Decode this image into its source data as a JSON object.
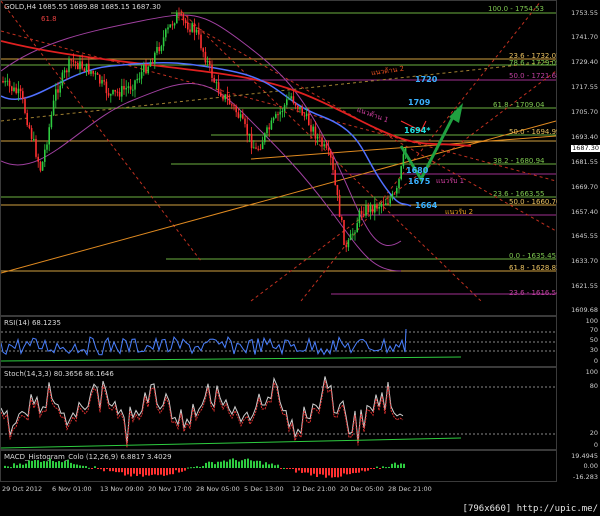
{
  "symbol_title": "GOLD,H4  1685.55 1689.88 1685.15 1687.30",
  "price_axis": [
    "1753.55",
    "1741.70",
    "1729.40",
    "1717.55",
    "1705.70",
    "1693.40",
    "1681.55",
    "1669.70",
    "1657.40",
    "1645.55",
    "1633.70",
    "1621.55",
    "1609.68"
  ],
  "current_price": "1687.30",
  "fib_labels": [
    {
      "text": "100.0 - 1754.53",
      "color": "#7ec850"
    },
    {
      "text": "23.6 - 1732.01",
      "color": "#e8c060"
    },
    {
      "text": "78.6 - 1729.05",
      "color": "#7ec850"
    },
    {
      "text": "50.0 - 1721.68",
      "color": "#c040a0"
    },
    {
      "text": "61.8 - 1709.04",
      "color": "#7ec850"
    },
    {
      "text": "50.0 - 1694.99",
      "color": "#e8c060"
    },
    {
      "text": "38.2 - 1680.94",
      "color": "#7ec850"
    },
    {
      "text": "23.6 - 1663.55",
      "color": "#7ec850"
    },
    {
      "text": "50.0 - 1660.70",
      "color": "#e8c060"
    },
    {
      "text": "0.0 - 1635.45",
      "color": "#7ec850"
    },
    {
      "text": "61.8 - 1628.83",
      "color": "#e8c060"
    },
    {
      "text": "23.6 - 1616.54",
      "color": "#c040a0"
    },
    {
      "text": "61.8",
      "color": "#e84040"
    }
  ],
  "annotations": [
    {
      "text": "1720",
      "color": "#3ab0ff"
    },
    {
      "text": "1709",
      "color": "#3ab0ff"
    },
    {
      "text": "1694*",
      "color": "#20e0e0"
    },
    {
      "text": "1680",
      "color": "#3ab0ff"
    },
    {
      "text": "1675",
      "color": "#3ab0ff"
    },
    {
      "text": "1664",
      "color": "#3ab0ff"
    },
    {
      "text": "แนวต้าน 2",
      "color": "#e85020"
    },
    {
      "text": "แนวต้าน 1",
      "color": "#d040a0"
    },
    {
      "text": "แนวรับ 1",
      "color": "#d040a0"
    },
    {
      "text": "แนวรับ 2",
      "color": "#e8a020"
    }
  ],
  "rsi": {
    "title": "RSI(14) 68.1235",
    "levels": [
      "100",
      "70",
      "50",
      "30",
      "0"
    ]
  },
  "stoch": {
    "title": "Stoch(14,3,3) 80.3656 86.1646",
    "levels": [
      "100",
      "80",
      "20",
      "0"
    ]
  },
  "macd": {
    "title": "MACD_Histogram_Colo (12,26,9) 6.8817 3.4029",
    "levels": [
      "19.4945",
      "0.00",
      "-16.283"
    ]
  },
  "time_axis": [
    "29 Oct 2012",
    "6 Nov 01:00",
    "13 Nov 09:00",
    "20 Nov 17:00",
    "28 Nov 05:00",
    "5 Dec 13:00",
    "12 Dec 21:00",
    "20 Dec 05:00",
    "28 Dec 21:00"
  ],
  "watermark": "[796x660] http://upic.me/",
  "colors": {
    "up": "#2ecc40",
    "down": "#ff3030",
    "ma_red": "#e02020",
    "ma_blue": "#5070ff",
    "bb": "#c050c0",
    "fib_green": "#7ec850",
    "fib_gold": "#e8b040"
  }
}
